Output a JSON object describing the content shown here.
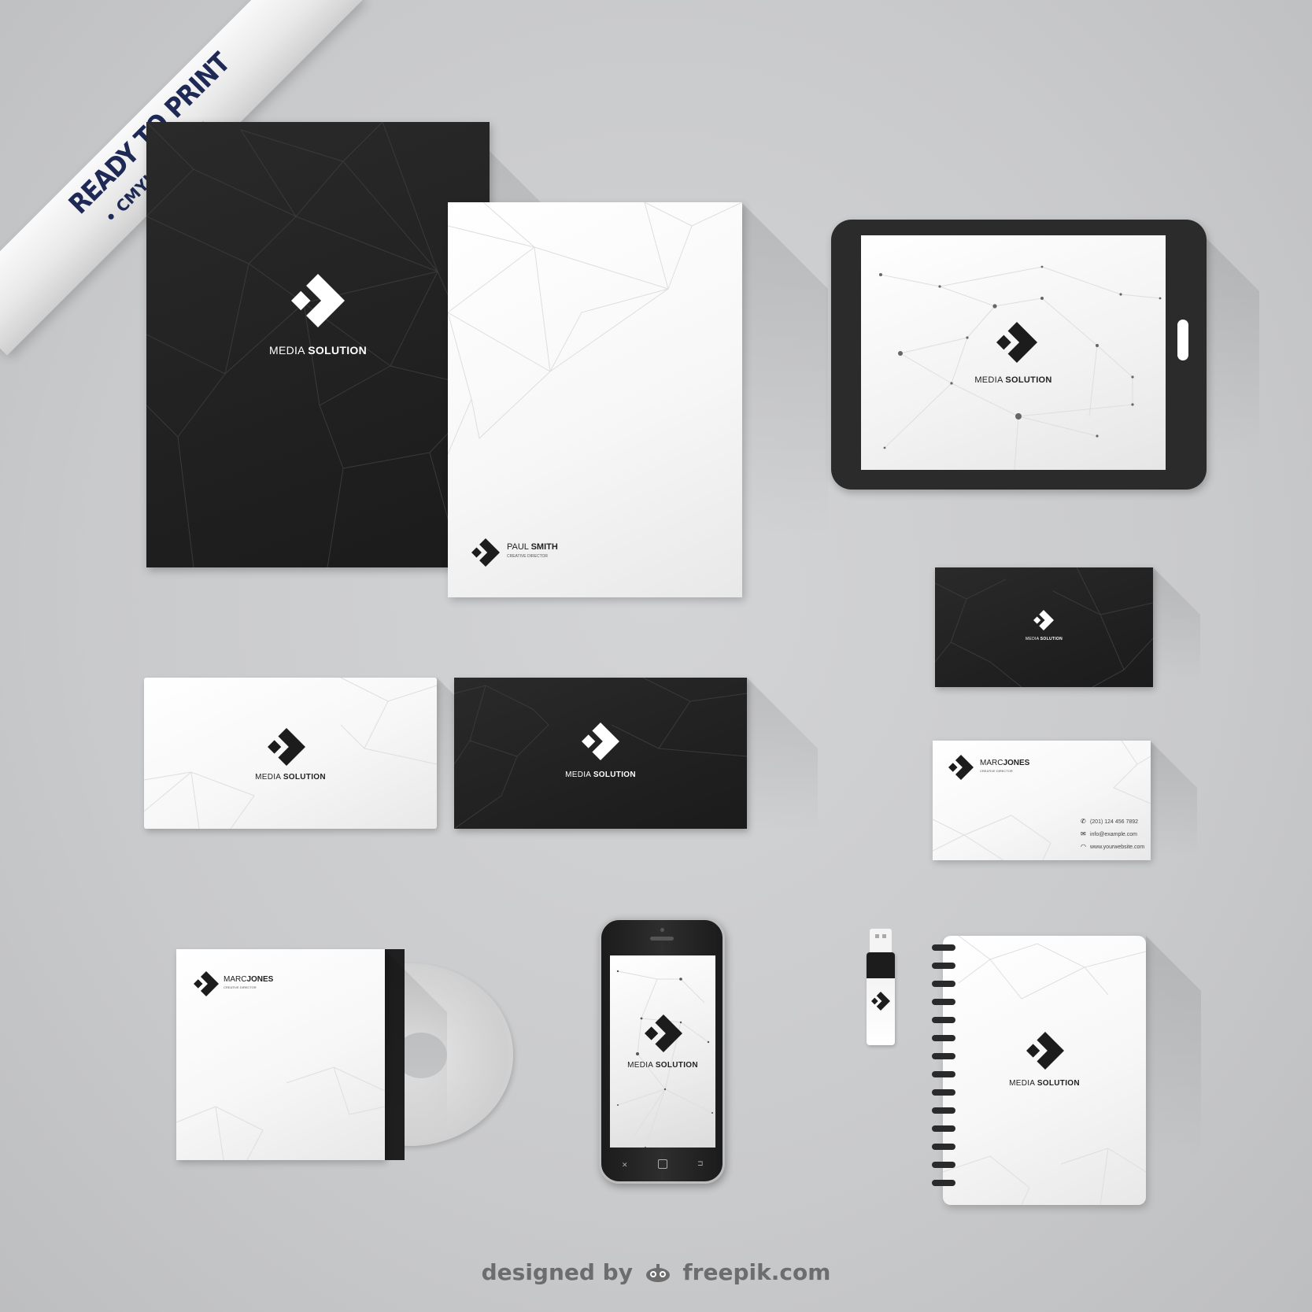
{
  "ribbon": {
    "line1": "READY TO PRINT",
    "line2": "CMYK MODE"
  },
  "brand": {
    "light_word": "MEDIA",
    "bold_word": "SOLUTION"
  },
  "letterhead": {
    "first_name": "PAUL",
    "last_name": "SMITH",
    "role": "CREATIVE DIRECTOR"
  },
  "business_card": {
    "first_name": "MARC",
    "last_name": "JONES",
    "role": "CREATIVE DIRECTOR",
    "phone": "(201) 124 456 7892",
    "email": "info@example.com",
    "website": "www.yourwebsite.com"
  },
  "cd_sleeve": {
    "first_name": "MARC",
    "last_name": "JONES",
    "role": "CREATIVE DIRECTOR"
  },
  "credit": {
    "prefix": "designed by",
    "site": "freepik.com"
  },
  "colors": {
    "background": "#cacbcd",
    "dark": "#232323",
    "light": "#f6f6f6",
    "ribbon_text": "#1e2a55"
  },
  "icons": [
    "logo-chevron-icon",
    "phone-icon",
    "mail-icon",
    "wifi-icon",
    "freepik-mascot-icon"
  ]
}
